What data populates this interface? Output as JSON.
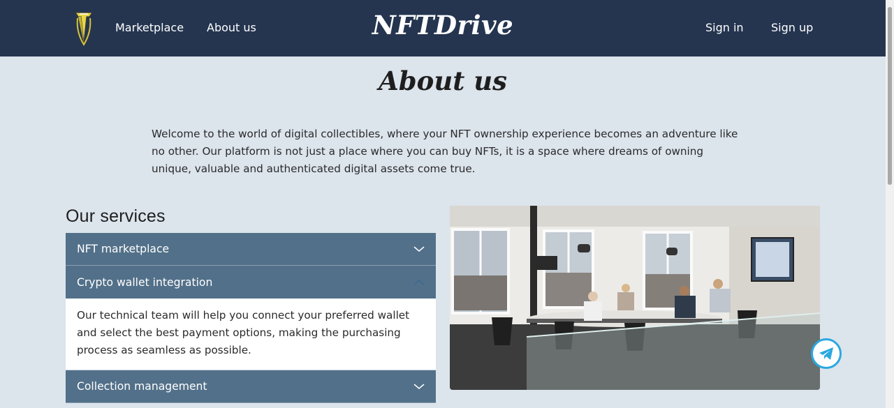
{
  "header": {
    "nav_marketplace": "Marketplace",
    "nav_about": "About us",
    "brand": "NFTDrive",
    "sign_in": "Sign in",
    "sign_up": "Sign up",
    "logo_icon": "car-emblem-logo"
  },
  "main": {
    "title": "About us",
    "intro": "Welcome to the world of digital collectibles, where your NFT ownership experience becomes an adventure like no other. Our platform is not just a place where you can buy NFTs, it is a space where dreams of owning unique, valuable and authenticated digital assets come true.",
    "services_title": "Our services",
    "services": [
      {
        "label": "NFT marketplace",
        "expanded": false
      },
      {
        "label": "Crypto wallet integration",
        "expanded": true,
        "body": "Our technical team will help you connect your preferred wallet and select the best payment options, making the purchasing process as seamless as possible."
      },
      {
        "label": "Collection management",
        "expanded": false
      }
    ],
    "photo_icon": "office-meeting-photo"
  },
  "floating": {
    "icon": "telegram-icon"
  },
  "colors": {
    "header_bg": "#253550",
    "page_bg": "#dce4ec",
    "accordion_bg": "#527089",
    "telegram": "#2aa8e0"
  }
}
